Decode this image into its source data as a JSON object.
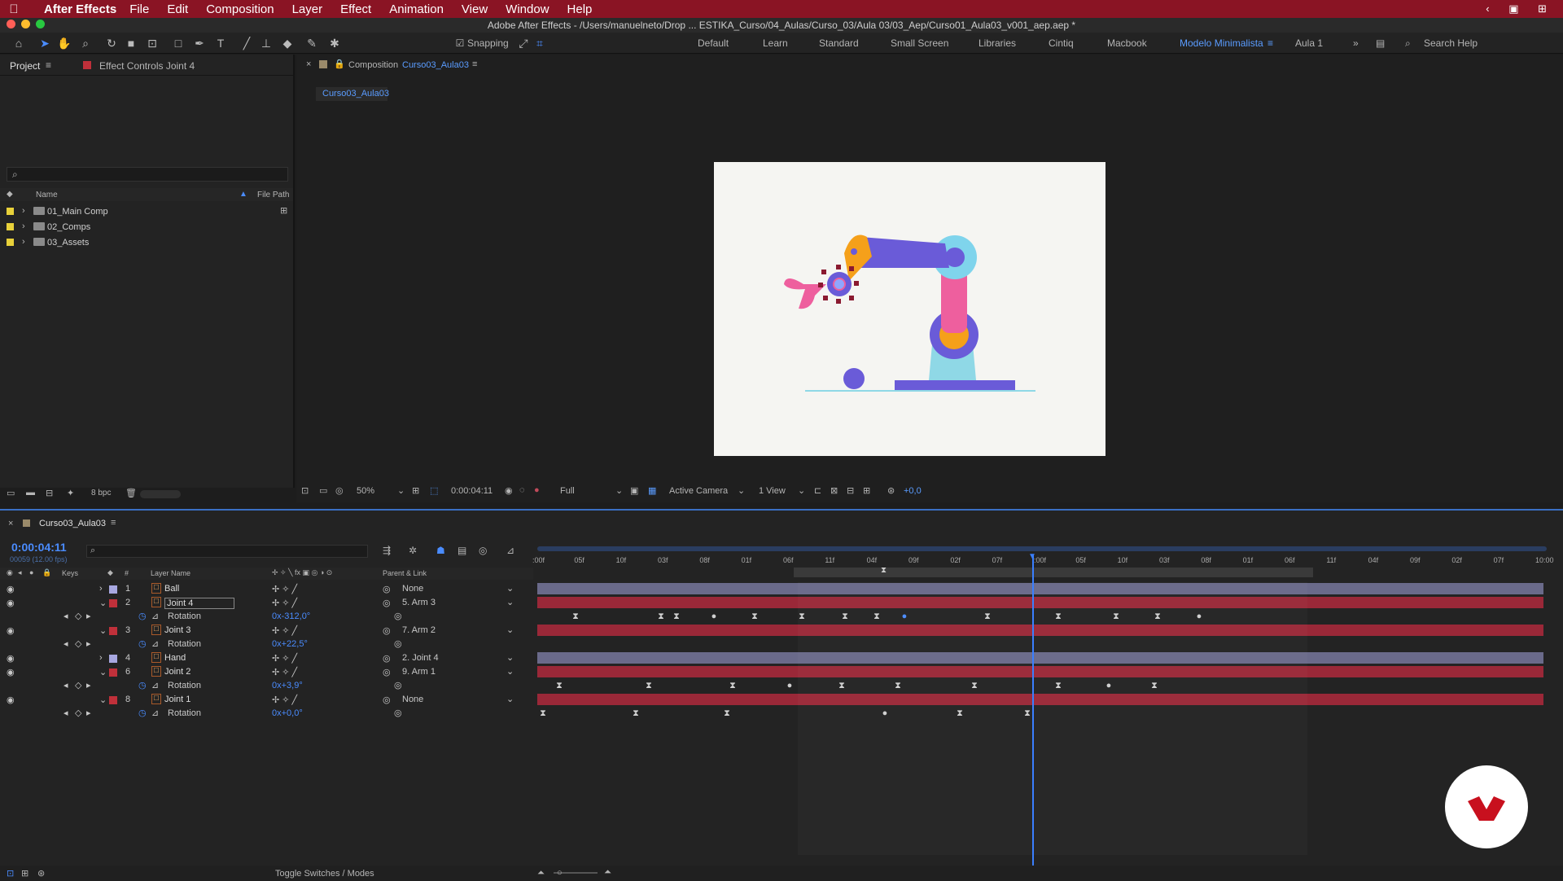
{
  "app": {
    "name": "After Effects",
    "menus": [
      "File",
      "Edit",
      "Composition",
      "Layer",
      "Effect",
      "Animation",
      "View",
      "Window",
      "Help"
    ],
    "title": "Adobe After Effects - /Users/manuelneto/Drop ... ESTIKA_Curso/04_Aulas/Curso_03/Aula 03/03_Aep/Curso01_Aula03_v001_aep.aep *"
  },
  "toolbar": {
    "snapping": "Snapping",
    "workspaces": [
      "Default",
      "Learn",
      "Standard",
      "Small Screen",
      "Libraries",
      "Cintiq",
      "Macbook",
      "Modelo Minimalista",
      "Aula 1"
    ],
    "active_workspace": "Modelo Minimalista",
    "search_placeholder": "Search Help"
  },
  "project": {
    "tab": "Project",
    "effect_tab": "Effect Controls Joint 4",
    "col_name": "Name",
    "col_path": "File Path",
    "bpc": "8 bpc",
    "items": [
      {
        "name": "01_Main Comp",
        "color": "#e8d13a"
      },
      {
        "name": "02_Comps",
        "color": "#e8d13a"
      },
      {
        "name": "03_Assets",
        "color": "#e8d13a"
      }
    ]
  },
  "composition": {
    "tab_prefix": "Composition",
    "tab_name": "Curso03_Aula03",
    "breadcrumb": "Curso03_Aula03",
    "zoom": "50%",
    "timecode": "0:00:04:11",
    "resolution": "Full",
    "camera": "Active Camera",
    "views": "1 View",
    "exposure": "+0,0"
  },
  "timeline": {
    "tab": "Curso03_Aula03",
    "timecode": "0:00:04:11",
    "frames": "00059 (12.00 fps)",
    "col_keys": "Keys",
    "col_num": "#",
    "col_layer": "Layer Name",
    "col_parent": "Parent & Link",
    "footer": "Toggle Switches / Modes",
    "ruler": [
      ":00f",
      "05f",
      "10f",
      "03f",
      "08f",
      "01f",
      "06f",
      "11f",
      "04f",
      "09f",
      "02f",
      "07f",
      ":00f",
      "05f",
      "10f",
      "03f",
      "08f",
      "01f",
      "06f",
      "11f",
      "04f",
      "09f",
      "02f",
      "07f",
      "10:00"
    ],
    "layers": [
      {
        "num": "1",
        "name": "Ball",
        "color": "#a7a7e0",
        "parent": "None",
        "expanded": false,
        "prop": null
      },
      {
        "num": "2",
        "name": "Joint 4",
        "color": "#c0303a",
        "parent": "5. Arm 3",
        "expanded": true,
        "prop": {
          "name": "Rotation",
          "value": "0x-312,0°"
        }
      },
      {
        "num": "3",
        "name": "Joint 3",
        "color": "#c0303a",
        "parent": "7. Arm 2",
        "expanded": true,
        "prop": {
          "name": "Rotation",
          "value": "0x+22,5°"
        }
      },
      {
        "num": "4",
        "name": "Hand",
        "color": "#a7a7e0",
        "parent": "2. Joint 4",
        "expanded": false,
        "prop": null
      },
      {
        "num": "6",
        "name": "Joint 2",
        "color": "#c0303a",
        "parent": "9. Arm 1",
        "expanded": true,
        "prop": {
          "name": "Rotation",
          "value": "0x+3,9°"
        }
      },
      {
        "num": "8",
        "name": "Joint 1",
        "color": "#c0303a",
        "parent": "None",
        "expanded": true,
        "prop": {
          "name": "Rotation",
          "value": "0x+0,0°"
        }
      }
    ]
  }
}
